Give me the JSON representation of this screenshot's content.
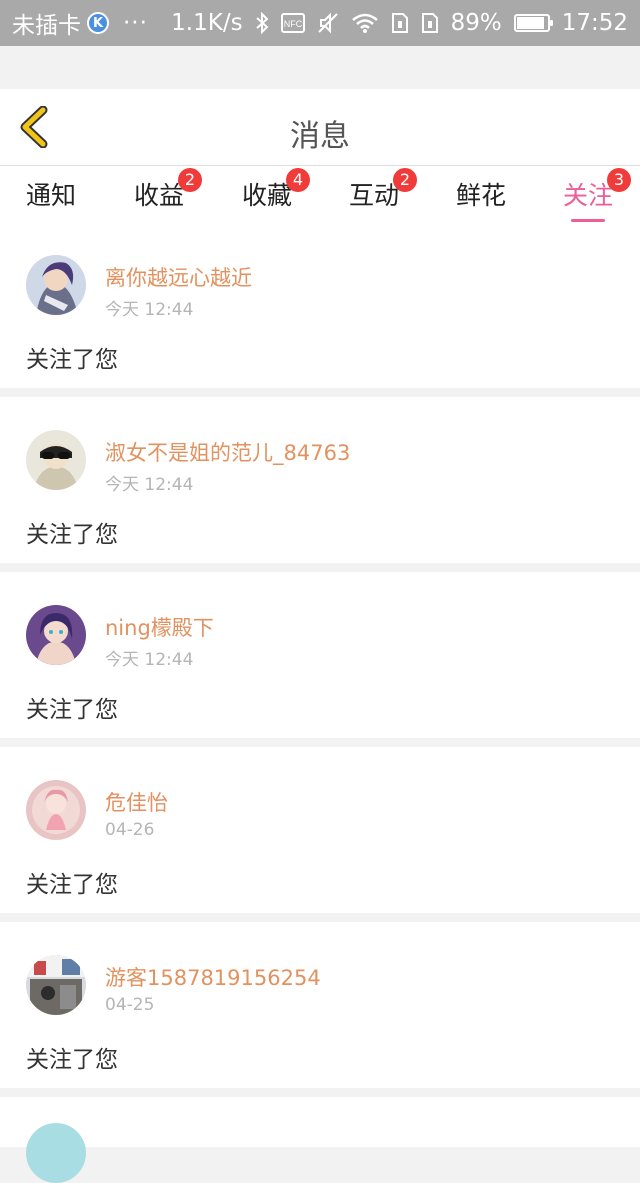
{
  "status_bar": {
    "carrier": "未插卡",
    "k_icon": "K",
    "dots": "···",
    "net_speed": "1.1K/s",
    "icons": [
      "bluetooth-icon",
      "nfc-icon",
      "mute-icon",
      "wifi-icon",
      "sim-icon",
      "sim2-icon"
    ],
    "battery_percent": "89%",
    "battery_level": 0.89,
    "time": "17:52"
  },
  "header": {
    "title": "消息",
    "back_icon": "chevron-left-icon",
    "back_color": "#f0c419"
  },
  "tabs": [
    {
      "label": "通知",
      "badge": ""
    },
    {
      "label": "收益",
      "badge": "2"
    },
    {
      "label": "收藏",
      "badge": "4"
    },
    {
      "label": "互动",
      "badge": "2"
    },
    {
      "label": "鲜花",
      "badge": ""
    },
    {
      "label": "关注",
      "badge": "3",
      "active": true
    }
  ],
  "colors": {
    "accent": "#ec5d9a",
    "username": "#e2925f",
    "badge": "#f03b3b"
  },
  "items": [
    {
      "username": "离你越远心越近",
      "time": "今天 12:44",
      "message": "关注了您",
      "avatar": "avatar-anime-boy"
    },
    {
      "username": "淑女不是姐的范儿_84763",
      "time": "今天 12:44",
      "message": "关注了您",
      "avatar": "avatar-sunglasses"
    },
    {
      "username": "ning檬殿下",
      "time": "今天 12:44",
      "message": "关注了您",
      "avatar": "avatar-anime-girl"
    },
    {
      "username": "危佳怡",
      "time": "04-26",
      "message": "关注了您",
      "avatar": "avatar-pink-girl"
    },
    {
      "username": "游客1587819156254",
      "time": "04-25",
      "message": "关注了您",
      "avatar": "avatar-photo"
    }
  ]
}
